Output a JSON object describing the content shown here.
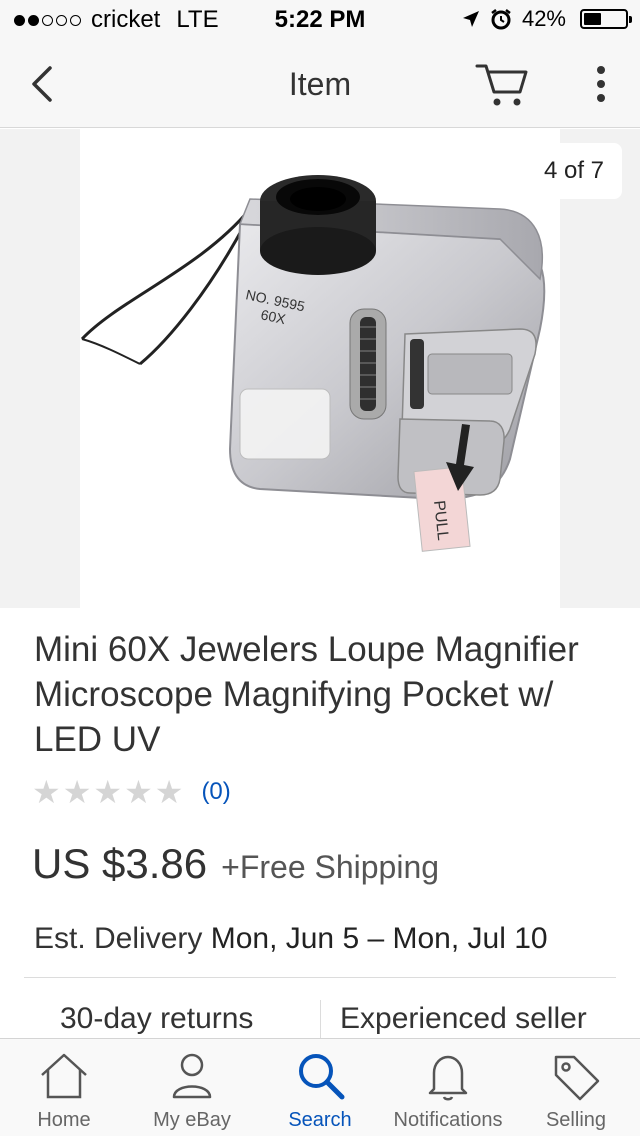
{
  "status_bar": {
    "carrier": "cricket",
    "network": "LTE",
    "time": "5:22 PM",
    "battery": "42%",
    "battery_level": 0.42
  },
  "nav": {
    "title": "Item",
    "back_icon": "chevron-left-icon",
    "cart_icon": "cart-icon",
    "more_icon": "more-vertical-icon"
  },
  "gallery": {
    "counter": "4 of 7",
    "image_labels": {
      "model": "NO. 9595",
      "magnification": "60X",
      "tab": "PULL"
    }
  },
  "item": {
    "title": "Mini 60X Jewelers Loupe Magnifier Microscope Magnifying Pocket w/ LED UV",
    "rating_stars": 0,
    "reviews": "(0)",
    "price": "US $3.86",
    "shipping": "+Free Shipping",
    "delivery_label": "Est. Delivery",
    "delivery_dates": "Mon, Jun 5 – Mon, Jul 10",
    "returns": "30-day returns",
    "seller": "Experienced seller"
  },
  "tabs": [
    {
      "label": "Home",
      "icon": "home-icon",
      "active": false
    },
    {
      "label": "My eBay",
      "icon": "user-icon",
      "active": false
    },
    {
      "label": "Search",
      "icon": "search-icon",
      "active": true
    },
    {
      "label": "Notifications",
      "icon": "bell-icon",
      "active": false
    },
    {
      "label": "Selling",
      "icon": "tag-icon",
      "active": false
    }
  ],
  "colors": {
    "accent": "#0654ba",
    "star_empty": "#d5d5d5",
    "bar_bg": "#f7f7f7"
  }
}
